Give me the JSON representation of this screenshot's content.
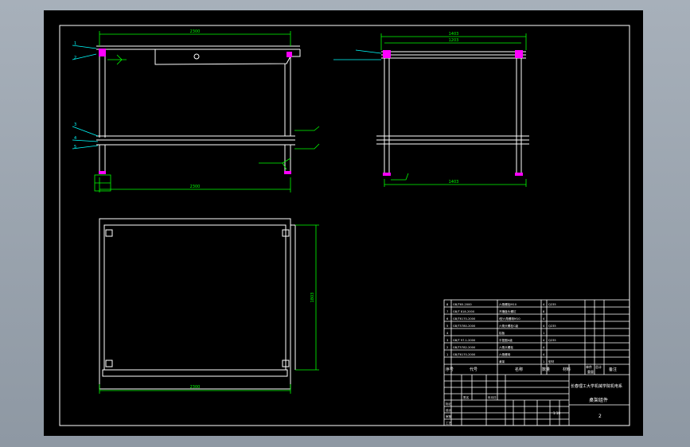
{
  "drawing": {
    "colors": {
      "background": "#000000",
      "frame": "#ffffff",
      "dimension": "#00ff00",
      "leader": "#00ffff",
      "highlight": "#ff00ff"
    },
    "front_view": {
      "top_dim": "2300",
      "bottom_dim": "2300",
      "leaders": [
        "1",
        "2",
        "3",
        "4",
        "5"
      ]
    },
    "side_view": {
      "top_dim_1": "1403",
      "top_dim_2": "1203",
      "bottom_dim": "1403"
    },
    "plan_view": {
      "bottom_dim": "2300",
      "right_dim": "1803"
    }
  },
  "title_block": {
    "parts": [
      {
        "no": "8",
        "code": "GB/T65-2000",
        "name": "六角螺栓M10",
        "qty": "4",
        "material": "Q235"
      },
      {
        "no": "7",
        "code": "GB/T 818-2000",
        "name": "开槽盘头螺钉",
        "qty": "8",
        "material": ""
      },
      {
        "no": "6",
        "code": "GB/T6170-2000",
        "name": "I型六角螺母M10",
        "qty": "4",
        "material": ""
      },
      {
        "no": "5",
        "code": "GB/T5780-2000",
        "name": "六角头螺栓C级",
        "qty": "4",
        "material": "Q235"
      },
      {
        "no": "4",
        "code": "",
        "name": "铝板",
        "qty": "1",
        "material": ""
      },
      {
        "no": "3",
        "code": "GB/T 97.1-2000",
        "name": "平垫圈A级",
        "qty": "4",
        "material": "Q235"
      },
      {
        "no": "2",
        "code": "GB/T5782-2000",
        "name": "六角头螺栓",
        "qty": "4",
        "material": ""
      },
      {
        "no": "1",
        "code": "GB/T6170-2000",
        "name": "六角螺母",
        "qty": "4",
        "material": ""
      },
      {
        "no": "",
        "code": "",
        "name": "桌架",
        "qty": "1",
        "material": "型材"
      }
    ],
    "headers": {
      "seq": "序号",
      "code": "代号",
      "name": "名称",
      "qty": "数量",
      "material": "材料",
      "unit_weight": "单件",
      "total_weight": "总计",
      "note": "备注",
      "weight": "重量"
    },
    "institution": "长春理工大学机械学院机电系",
    "drawing_name": "桌架组件",
    "sheet_no": "2",
    "scale": "1:10",
    "row_labels": [
      "标记",
      "处数",
      "分区",
      "更改文件号",
      "签名",
      "年月日",
      "设计",
      "审核",
      "工艺",
      "批准"
    ]
  }
}
